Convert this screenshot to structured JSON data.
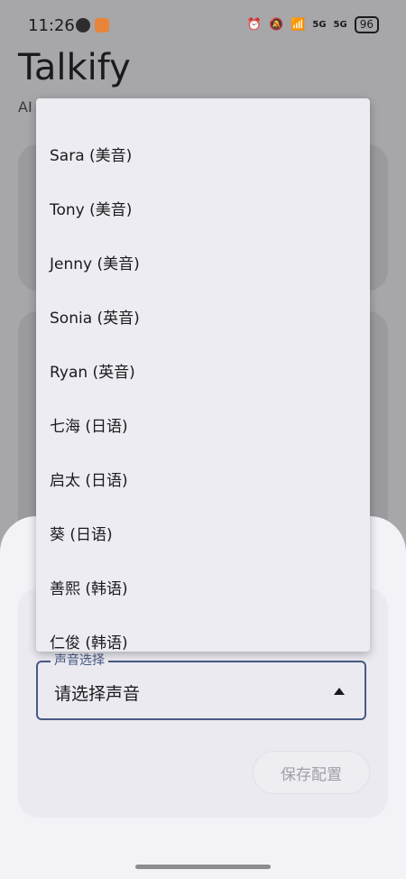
{
  "status_bar": {
    "time": "11:26",
    "network_5g_1": "5G",
    "network_5g_2": "5G",
    "battery": "96"
  },
  "app": {
    "title": "Talkify",
    "subtitle": "AI 语音合成"
  },
  "dropdown": {
    "items": [
      "Sara (美音)",
      "Tony (美音)",
      "Jenny (美音)",
      "Sonia (英音)",
      "Ryan (英音)",
      "七海 (日语)",
      "启太 (日语)",
      "葵 (日语)",
      "善熙 (韩语)",
      "仁俊 (韩语)"
    ]
  },
  "sheet": {
    "voice_field_label": "声音选择",
    "voice_field_value": "请选择声音",
    "save_label": "保存配置"
  },
  "colors": {
    "accent": "#475a85",
    "scrim": "#a7a6a9",
    "sheet": "#f3f2f7"
  }
}
